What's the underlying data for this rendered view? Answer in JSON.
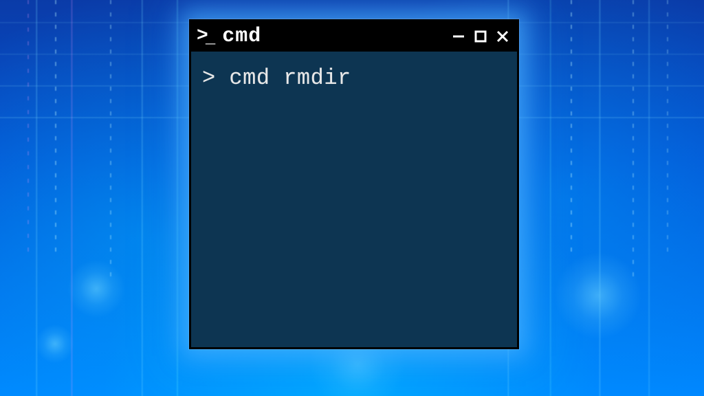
{
  "background": {
    "accent_color": "#00a0ff",
    "glow_color": "#60d0ff"
  },
  "window": {
    "icon_name": "terminal-prompt-icon",
    "title": "cmd",
    "controls": {
      "minimize": "minimize",
      "maximize": "maximize",
      "close": "close"
    }
  },
  "terminal": {
    "prompt": ">",
    "command": "cmd rmdir",
    "line": "> cmd rmdir",
    "body_bg": "#0d3552",
    "text_color": "#e8e8e8"
  }
}
